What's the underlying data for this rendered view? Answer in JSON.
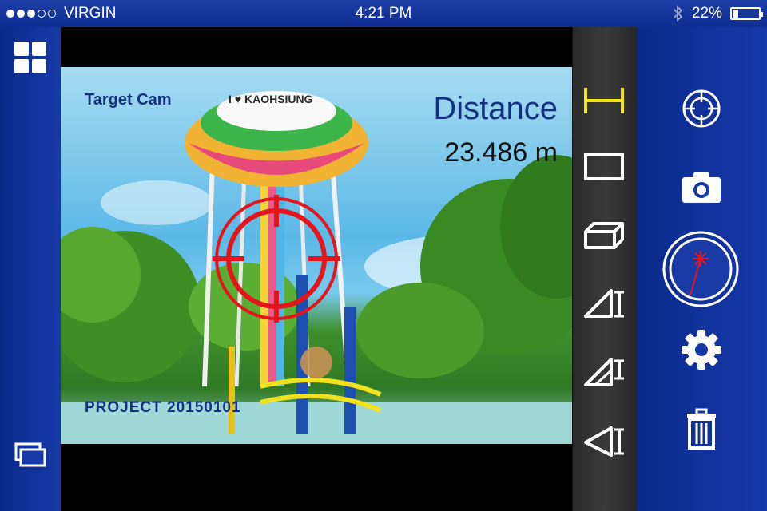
{
  "status_bar": {
    "carrier": "VIRGIN",
    "time": "4:21 PM",
    "battery_text": "22%",
    "battery_level": 0.22,
    "signal_bars_filled": 3,
    "signal_bars_total": 5
  },
  "viewfinder": {
    "label": "Target Cam",
    "distance_label": "Distance",
    "distance_value": "23.486 m",
    "project_label": "PROJECT 20150101",
    "banner_text": "I ♥ KAOHSIUNG"
  },
  "tools": [
    {
      "icon": "distance-measure-icon"
    },
    {
      "icon": "area-measure-icon"
    },
    {
      "icon": "volume-measure-icon"
    },
    {
      "icon": "angle-measure-icon"
    },
    {
      "icon": "triangle-height-icon"
    },
    {
      "icon": "triangle-base-icon"
    }
  ],
  "colors": {
    "panel_blue": "#0f2d92",
    "crosshair_red": "#e4161b",
    "text_navy": "#14307f",
    "tool_highlight": "#f5e416"
  }
}
